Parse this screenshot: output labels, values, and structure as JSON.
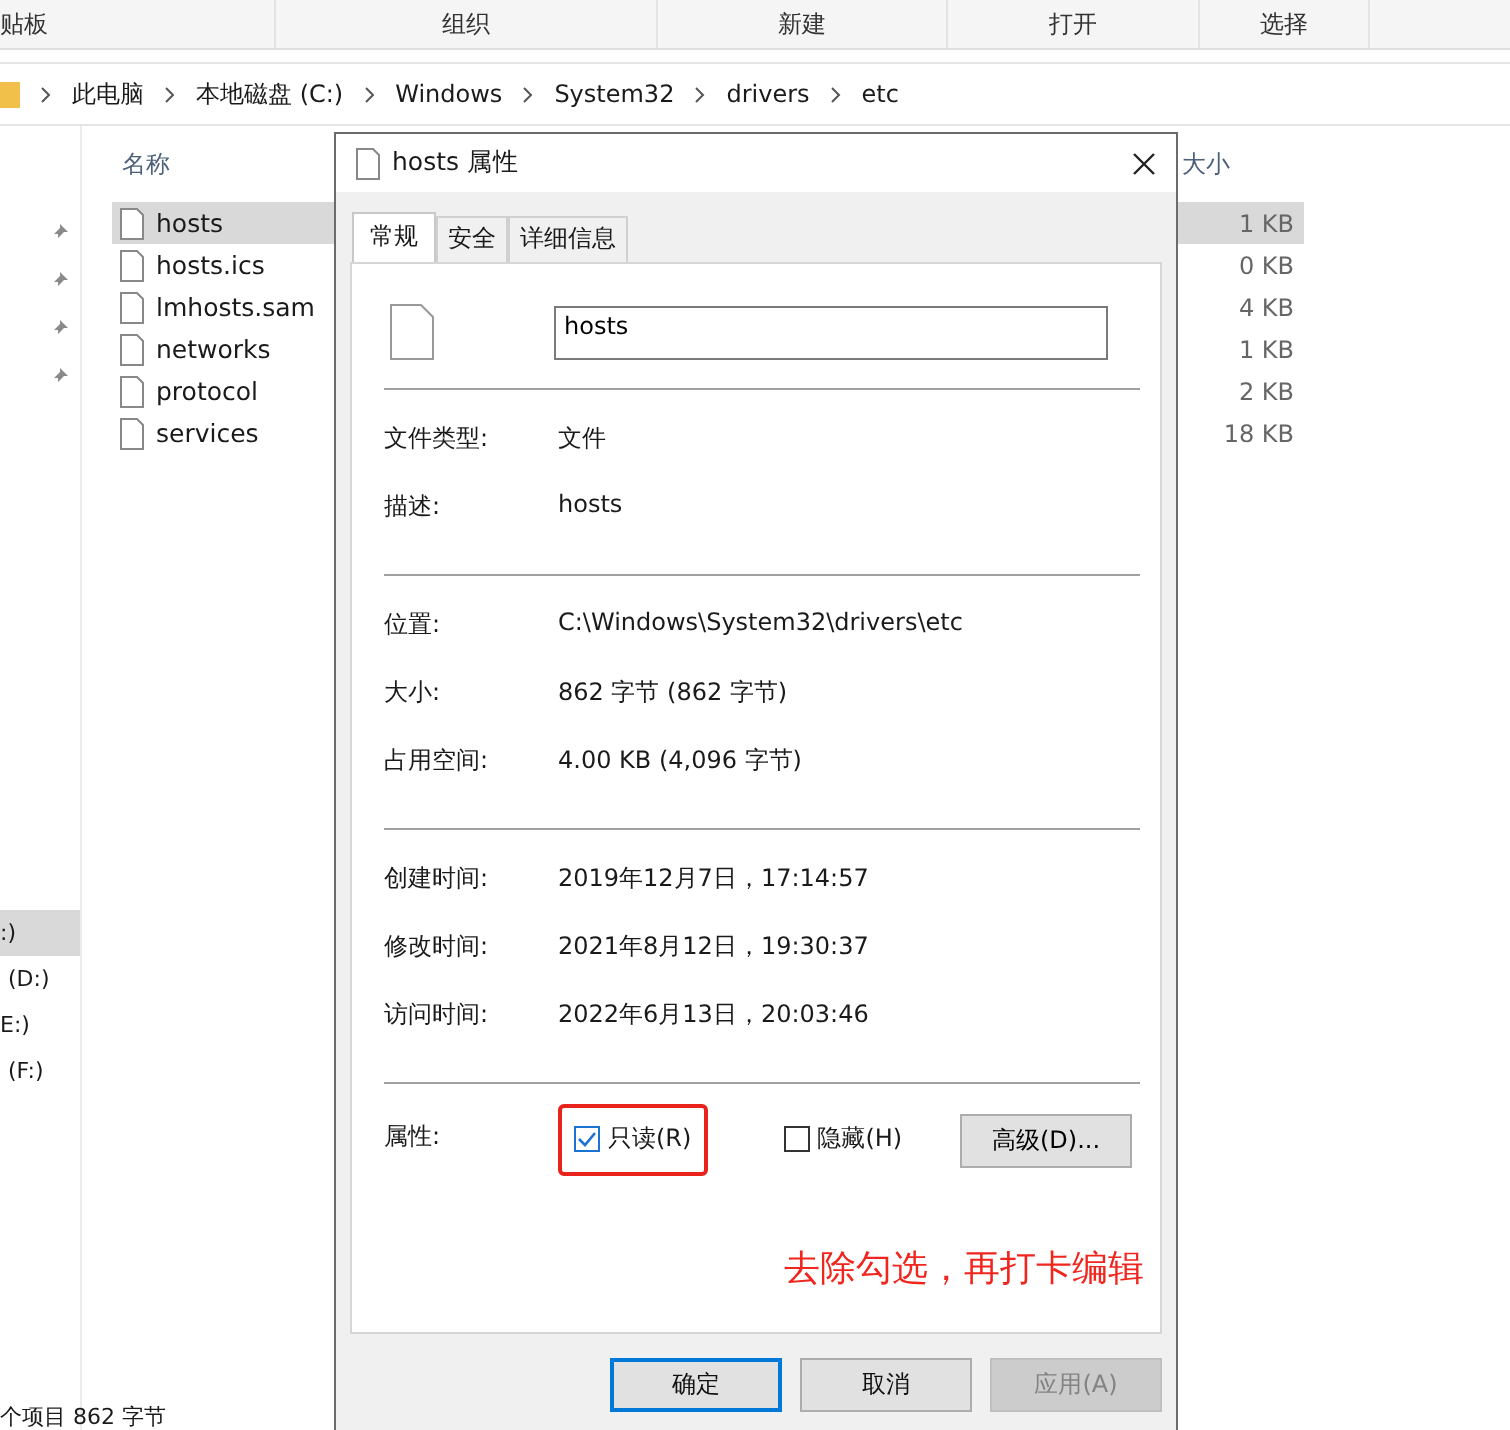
{
  "ribbon": {
    "groups": [
      "贴板",
      "组织",
      "新建",
      "打开",
      "选择"
    ]
  },
  "address_bar": {
    "crumbs": [
      "此电脑",
      "本地磁盘 (C:)",
      "Windows",
      "System32",
      "drivers",
      "etc"
    ]
  },
  "nav_pane": {
    "drives": [
      {
        "label": ":)",
        "selected": true
      },
      {
        "label": "(D:)",
        "selected": false
      },
      {
        "label": "E:)",
        "selected": false
      },
      {
        "label": "(F:)",
        "selected": false
      }
    ]
  },
  "file_list": {
    "columns": [
      "名称",
      "大小"
    ],
    "rows": [
      {
        "name": "hosts",
        "size": "1 KB",
        "selected": true
      },
      {
        "name": "hosts.ics",
        "size": "0 KB",
        "selected": false
      },
      {
        "name": "lmhosts.sam",
        "size": "4 KB",
        "selected": false
      },
      {
        "name": "networks",
        "size": "1 KB",
        "selected": false
      },
      {
        "name": "protocol",
        "size": "2 KB",
        "selected": false
      },
      {
        "name": "services",
        "size": "18 KB",
        "selected": false
      }
    ]
  },
  "status_bar": "个项目  862 字节",
  "dialog": {
    "title": "hosts 属性",
    "tabs": [
      {
        "label": "常规",
        "selected": true
      },
      {
        "label": "安全",
        "selected": false
      },
      {
        "label": "详细信息",
        "selected": false
      }
    ],
    "file_name": "hosts",
    "sections": [
      [
        {
          "label": "文件类型:",
          "value": "文件"
        },
        {
          "label": "描述:",
          "value": "hosts"
        }
      ],
      [
        {
          "label": "位置:",
          "value": "C:\\Windows\\System32\\drivers\\etc"
        },
        {
          "label": "大小:",
          "value": "862 字节 (862 字节)"
        },
        {
          "label": "占用空间:",
          "value": "4.00 KB (4,096 字节)"
        }
      ],
      [
        {
          "label": "创建时间:",
          "value": "2019年12月7日，17:14:57"
        },
        {
          "label": "修改时间:",
          "value": "2021年8月12日，19:30:37"
        },
        {
          "label": "访问时间:",
          "value": "2022年6月13日，20:03:46"
        }
      ]
    ],
    "attributes_label": "属性:",
    "checkboxes": [
      {
        "label": "只读(R)",
        "checked": true,
        "highlighted": true
      },
      {
        "label": "隐藏(H)",
        "checked": false,
        "highlighted": false
      }
    ],
    "advanced_button": "高级(D)...",
    "annotation": "去除勾选，再打卡编辑",
    "buttons": [
      {
        "label": "确定",
        "kind": "default"
      },
      {
        "label": "取消",
        "kind": "normal"
      },
      {
        "label": "应用(A)",
        "kind": "disabled"
      }
    ]
  }
}
